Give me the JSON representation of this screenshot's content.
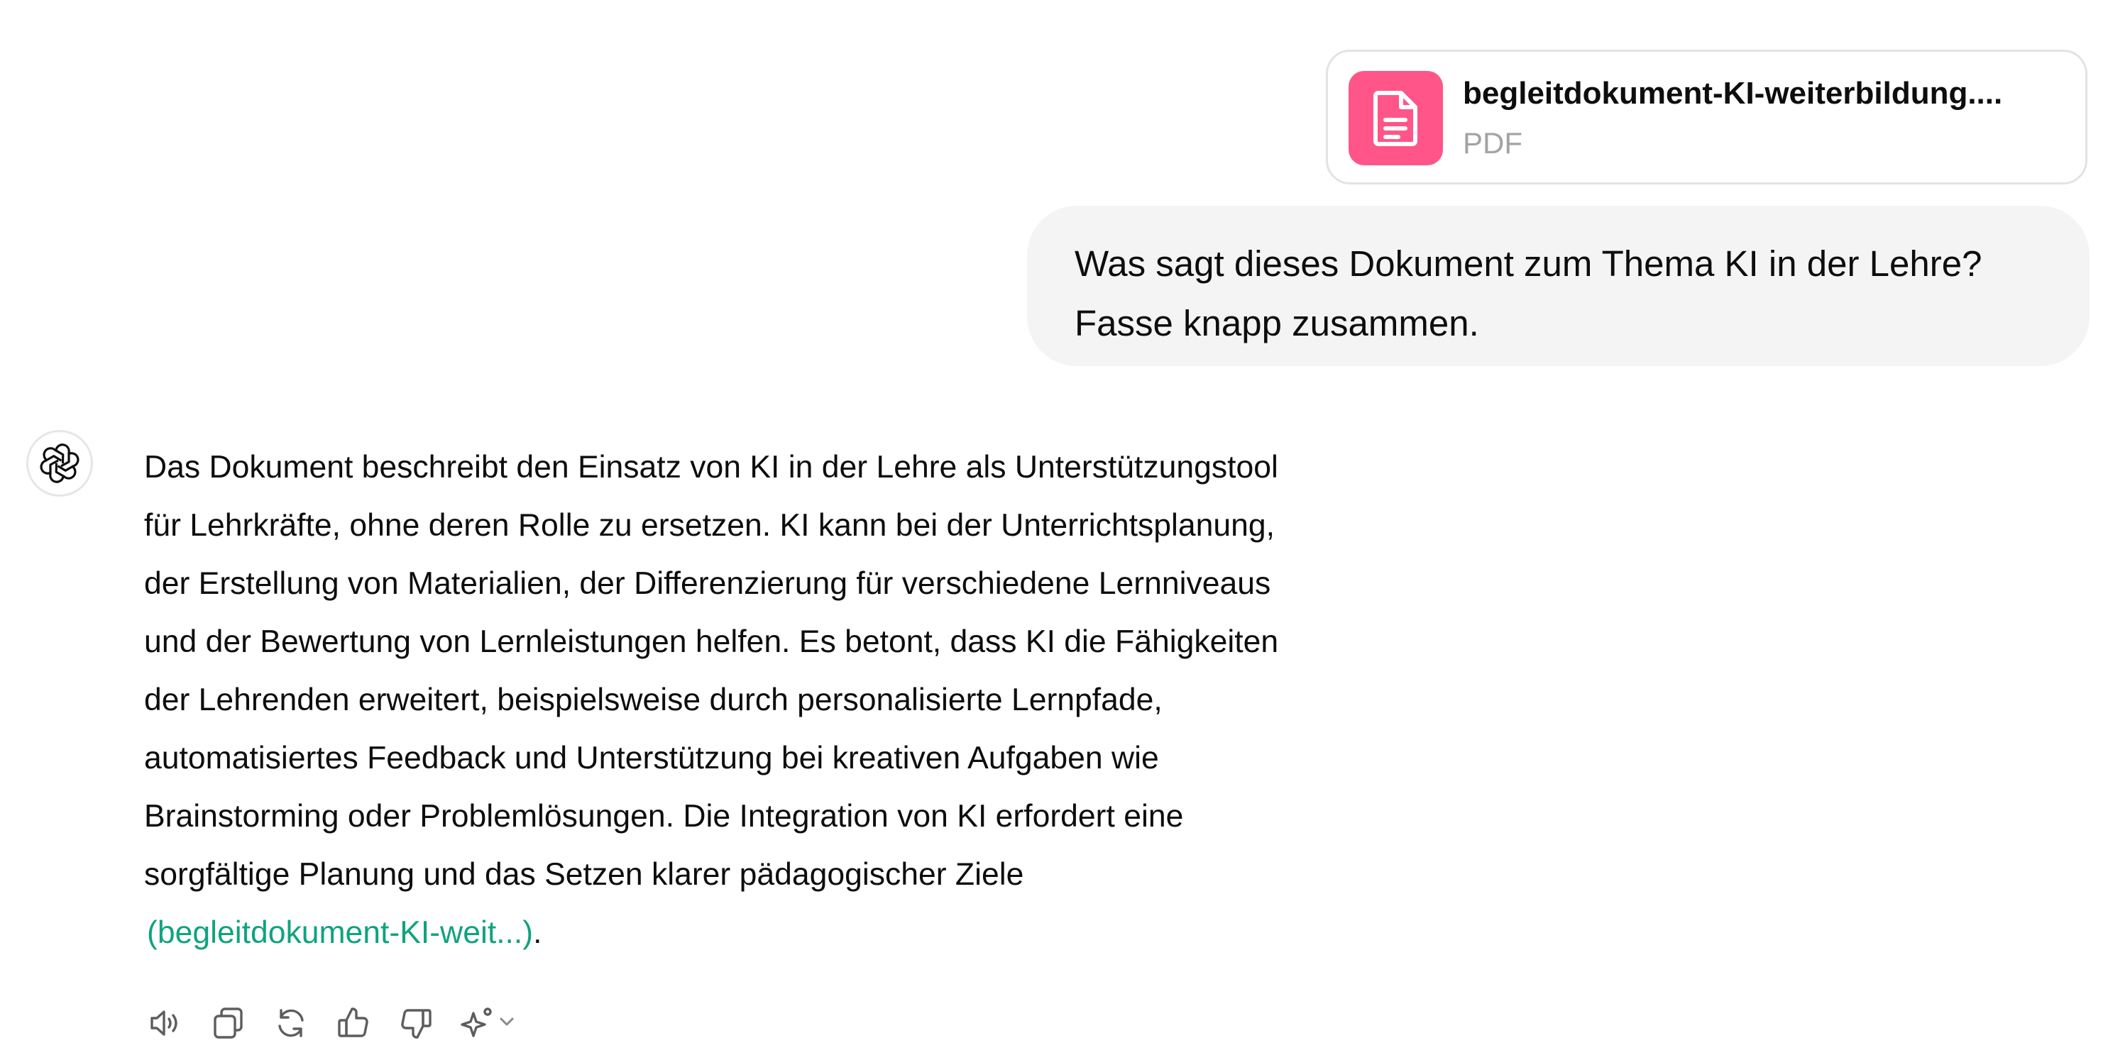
{
  "attachment": {
    "file_name": "begleitdokument-KI-weiterbildung....",
    "file_type": "PDF",
    "icon": "document-icon",
    "icon_color": "#ff5588"
  },
  "user_message": {
    "text": "Was sagt dieses Dokument zum Thema KI in der Lehre?\nFasse knapp zusammen."
  },
  "assistant": {
    "avatar_icon": "openai-logo-icon",
    "text": "Das Dokument beschreibt den Einsatz von KI in der Lehre als Unterstützungstool\nfür Lehrkräfte, ohne deren Rolle zu ersetzen. KI kann bei der Unterrichtsplanung,\nder Erstellung von Materialien, der Differenzierung für verschiedene Lernniveaus\nund der Bewertung von Lernleistungen helfen. Es betont, dass KI die Fähigkeiten\nder Lehrenden erweitert, beispielsweise durch personalisierte Lernpfade,\nautomatisiertes Feedback und Unterstützung bei kreativen Aufgaben wie\nBrainstorming oder Problemlösungen. Die Integration von KI erfordert eine\nsorgfältige Planung und das Setzen klarer pädagogischer Ziele",
    "citation": "(begleitdokument-KI-weit...)",
    "citation_suffix": ".",
    "citation_color": "#10a37f"
  },
  "actions": [
    {
      "name": "read-aloud",
      "icon": "speaker-icon"
    },
    {
      "name": "copy",
      "icon": "copy-icon"
    },
    {
      "name": "regenerate",
      "icon": "refresh-icon"
    },
    {
      "name": "thumbs-up",
      "icon": "thumbs-up-icon"
    },
    {
      "name": "thumbs-down",
      "icon": "thumbs-down-icon"
    },
    {
      "name": "switch-model",
      "icon": "sparkle-icon"
    }
  ]
}
